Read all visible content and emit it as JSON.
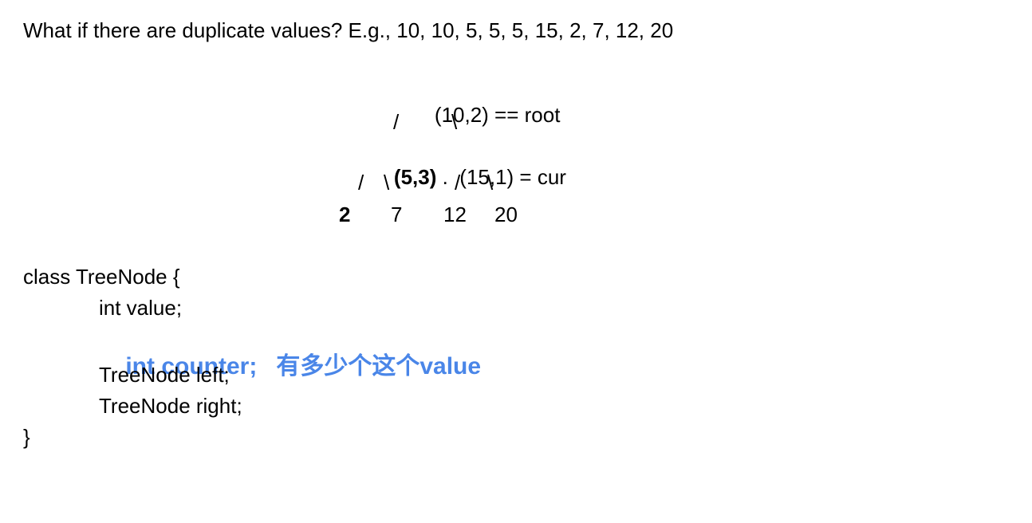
{
  "question": "What if there are duplicate values? E.g., 10, 10, 5, 5, 5, 15, 2, 7, 12, 20",
  "tree": {
    "root": {
      "label": "(10,2)",
      "annotation": " == root"
    },
    "edge_root_left": "/",
    "edge_root_right": "\\",
    "left": {
      "label": "(5,3)",
      "trailing": " .  "
    },
    "right": {
      "label": "(15,1)",
      "annotation": " = cur"
    },
    "edge_left_left": "/",
    "edge_left_right": "\\",
    "edge_right_left": "/",
    "edge_right_right": "\\",
    "leaves": [
      "2",
      "7",
      "12",
      "20"
    ]
  },
  "code": {
    "class_open": "class TreeNode {",
    "field_value": "int value;",
    "field_counter": "int counter;",
    "field_counter_note": "有多少个这个value",
    "field_left": "TreeNode left;",
    "field_right": "TreeNode right;",
    "class_close": "}"
  },
  "colors": {
    "accent": "#4a86e8",
    "text": "#000000",
    "background": "#ffffff"
  }
}
